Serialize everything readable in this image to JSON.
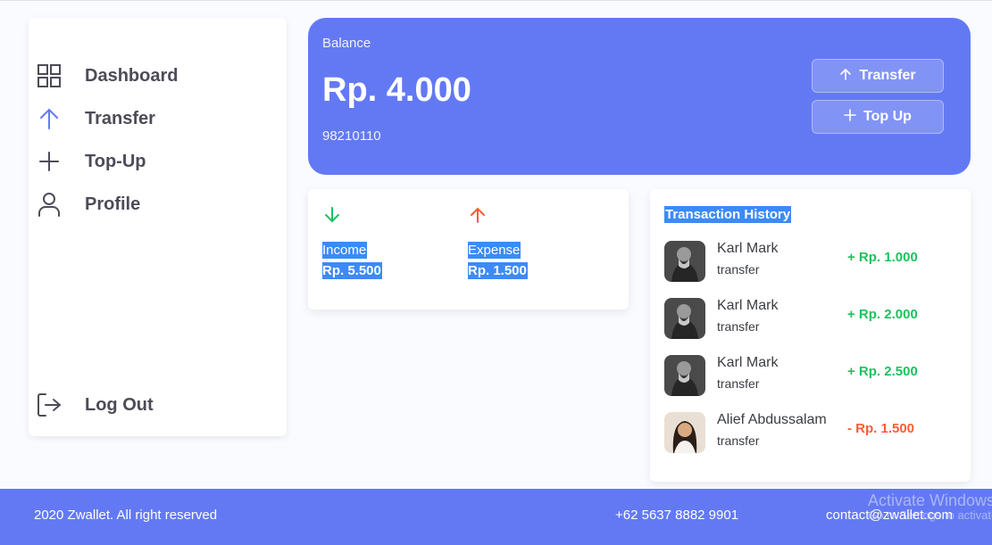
{
  "sidebar": {
    "items": [
      {
        "label": "Dashboard",
        "icon": "grid-icon"
      },
      {
        "label": "Transfer",
        "icon": "arrow-up-icon"
      },
      {
        "label": "Top-Up",
        "icon": "plus-icon"
      },
      {
        "label": "Profile",
        "icon": "user-icon"
      }
    ],
    "logout": {
      "label": "Log Out",
      "icon": "logout-icon"
    }
  },
  "balance": {
    "label": "Balance",
    "amount": "Rp. 4.000",
    "phone": "98210110",
    "transfer_label": "Transfer",
    "topup_label": "Top Up"
  },
  "stats": {
    "income": {
      "label": "Income",
      "value": "Rp. 5.500"
    },
    "expense": {
      "label": "Expense",
      "value": "Rp. 1.500"
    }
  },
  "history": {
    "title": "Transaction History",
    "items": [
      {
        "name": "Karl Mark",
        "type": "transfer",
        "amount": "+ Rp. 1.000",
        "direction": "in"
      },
      {
        "name": "Karl Mark",
        "type": "transfer",
        "amount": "+ Rp. 2.000",
        "direction": "in"
      },
      {
        "name": "Karl Mark",
        "type": "transfer",
        "amount": "+ Rp. 2.500",
        "direction": "in"
      },
      {
        "name": "Alief Abdussalam",
        "type": "transfer",
        "amount": "- Rp. 1.500",
        "direction": "out"
      }
    ]
  },
  "footer": {
    "copyright": "2020 Zwallet. All right reserved",
    "phone": "+62 5637 8882 9901",
    "email": "contact@zwallet.com"
  },
  "watermark": {
    "line1": "Activate Windows",
    "line2": "Go to Settings to activate Windows."
  },
  "colors": {
    "primary": "#6379f4",
    "income": "#1ec15f",
    "expense": "#ff5b37",
    "selection": "#3d8af7"
  }
}
